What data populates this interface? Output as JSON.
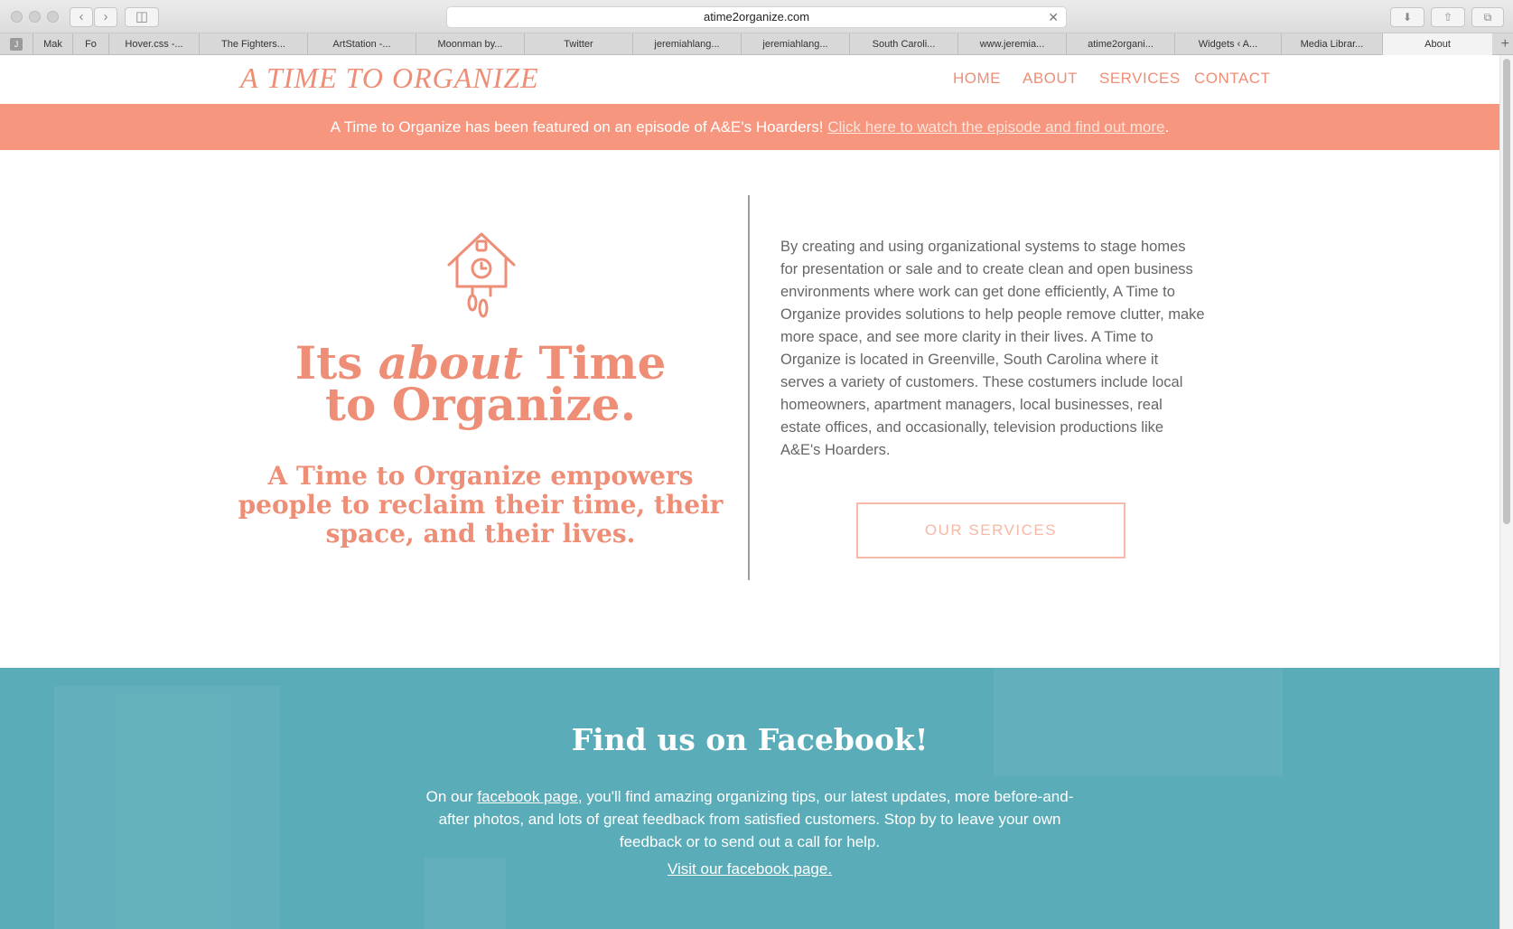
{
  "browser": {
    "url": "atime2organize.com",
    "tabs": [
      "Mak",
      "Fo",
      "Hover.css -...",
      "The Fighters...",
      "ArtStation -...",
      "Moonman by...",
      "Twitter",
      "jeremiahlang...",
      "jeremiahlang...",
      "South Caroli...",
      "www.jeremia...",
      "atime2organi...",
      "Widgets ‹ A...",
      "Media Librar...",
      "About"
    ],
    "first_tab_icon": "J"
  },
  "site": {
    "logo": "A TIME TO ORGANIZE",
    "nav": [
      "HOME",
      "ABOUT",
      "SERVICES",
      "CONTACT"
    ],
    "banner_text": "A Time to Organize has been featured on an episode of A&E's Hoarders! ",
    "banner_link": "Click here to watch the episode and find out more",
    "banner_end": "."
  },
  "hero": {
    "icon": "cuckoo-clock-icon",
    "title_part1": "Its ",
    "title_italic": "about",
    "title_part2": " Time",
    "title_line2": "to Organize.",
    "subtitle": "A Time to Organize empowers people to reclaim their time, their space, and their lives."
  },
  "about": {
    "text": "By creating and using organizational systems to stage homes for presentation or sale and to create clean and open business environments where work can get done efficiently, A Time to Organize provides solutions to help people remove clutter, make more space, and see more clarity in their lives. A Time to Organize is located in Greenville, South Carolina where it serves a variety of customers. These costumers include local homeowners, apartment managers, local businesses, real estate offices, and occasionally, television productions like A&E's Hoarders.",
    "button": "OUR SERVICES"
  },
  "facebook": {
    "title": "Find us on Facebook!",
    "text_before": "On our ",
    "text_link": "facebook page",
    "text_after": ", you'll find amazing organizing tips, our latest updates, more before-and-after photos, and lots of great feedback from satisfied customers. Stop by to leave your own feedback or to send out a call for help.",
    "visit_link": "Visit our facebook page."
  },
  "colors": {
    "accent": "#ee8e76",
    "banner": "#f7967f",
    "facebook_bg": "#5aacb8",
    "body_text": "#666666"
  }
}
